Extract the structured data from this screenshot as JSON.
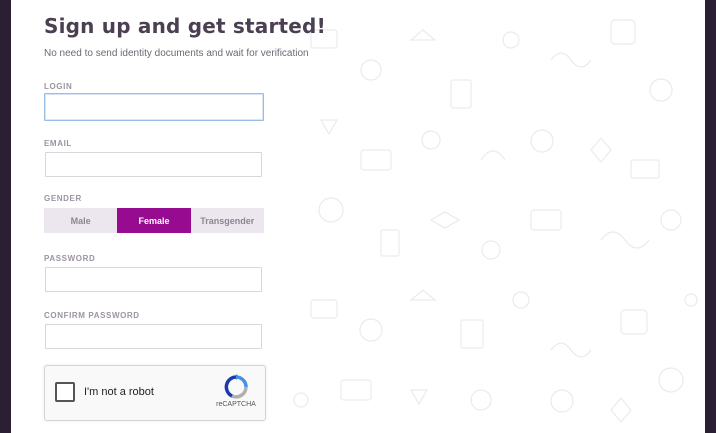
{
  "page": {
    "title": "Sign up and get started!",
    "subtitle": "No need to send identity documents and wait for verification"
  },
  "form": {
    "login": {
      "label": "LOGIN",
      "value": ""
    },
    "email": {
      "label": "EMAIL",
      "value": ""
    },
    "gender": {
      "label": "GENDER",
      "options": [
        "Male",
        "Female",
        "Transgender"
      ],
      "selected": "Female"
    },
    "password": {
      "label": "PASSWORD",
      "value": ""
    },
    "confirm_password": {
      "label": "CONFIRM PASSWORD",
      "value": ""
    }
  },
  "captcha": {
    "label": "I'm not a robot",
    "brand": "reCAPTCHA",
    "checked": false
  },
  "colors": {
    "accent": "#960b8f",
    "title": "#4b4052",
    "outer_background": "#2a1f33"
  },
  "icons": [
    "recaptcha-logo-icon",
    "doodle-pattern"
  ]
}
